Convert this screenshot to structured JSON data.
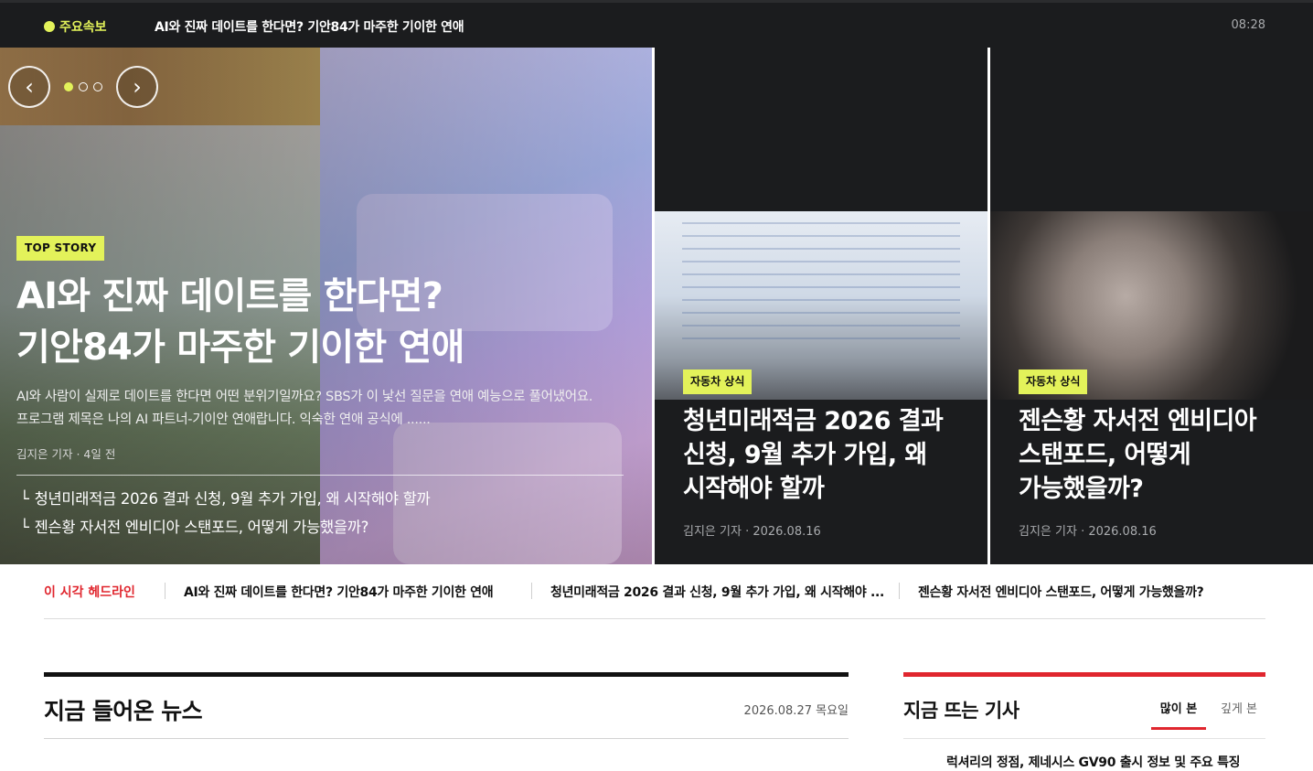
{
  "ticker": {
    "live_label": "주요속보",
    "headline": "AI와 진짜 데이트를 한다면? 기안84가 마주한 기이한 연애",
    "time": "08:28"
  },
  "hero": {
    "badge": "TOP STORY",
    "title_line1": "AI와 진짜 데이트를 한다면?",
    "title_line2": "기안84가 마주한 기이한 연애",
    "summary_line1": "AI와 사람이 실제로 데이트를 한다면 어떤 분위기일까요? SBS가 이 낯선 질문을 연애 예능으로 풀어냈어요.",
    "summary_line2": "프로그램 제목은 나의 AI 파트너-기이안 연애랍니다. 익숙한 연애 공식에 ......",
    "byline": "김지은 기자 · 4일 전",
    "related": [
      {
        "mark": "└",
        "text": "청년미래적금 2026 결과 신청, 9월 추가 가입, 왜 시작해야 할까"
      },
      {
        "mark": "└",
        "text": "젠슨황 자서전 엔비디아 스탠포드, 어떻게 가능했을까?"
      }
    ],
    "carousel": {
      "prev": "‹",
      "next": "›",
      "total": 3,
      "active": 1
    }
  },
  "cards": [
    {
      "badge": "자동차 상식",
      "title_lines": [
        "청년미래적금 2026 결과",
        "신청, 9월 추가 가입, 왜",
        "시작해야 할까"
      ],
      "byline": "김지은 기자 · 2026.08.16"
    },
    {
      "badge": "자동차 상식",
      "title_lines": [
        "젠슨황 자서전 엔비디아",
        "스탠포드, 어떻게",
        "가능했을까?"
      ],
      "byline": "김지은 기자 · 2026.08.16"
    }
  ],
  "headlines_strip": {
    "label": "이 시각 헤드라인",
    "items": [
      "AI와 진짜 데이트를 한다면? 기안84가 마주한 기이한 연애",
      "청년미래적금 2026 결과 신청, 9월 추가 가입, 왜 시작해야 ...",
      "젠슨황 자서전 엔비디아 스탠포드, 어떻게 가능했을까?"
    ]
  },
  "news": {
    "title": "지금 들어온 뉴스",
    "date": "2026.08.27 목요일"
  },
  "trending": {
    "title": "지금 뜨는 기사",
    "tabs": [
      {
        "label": "많이 본",
        "active": true
      },
      {
        "label": "깊게 본",
        "active": false
      }
    ],
    "first_item": "럭셔리의 정점, 제네시스 GV90 출시 정보 및 주요 특징"
  },
  "colors": {
    "accent_yellow": "#e3f25a",
    "accent_red": "#e0262e",
    "dark_bg": "#1b1c1e"
  }
}
